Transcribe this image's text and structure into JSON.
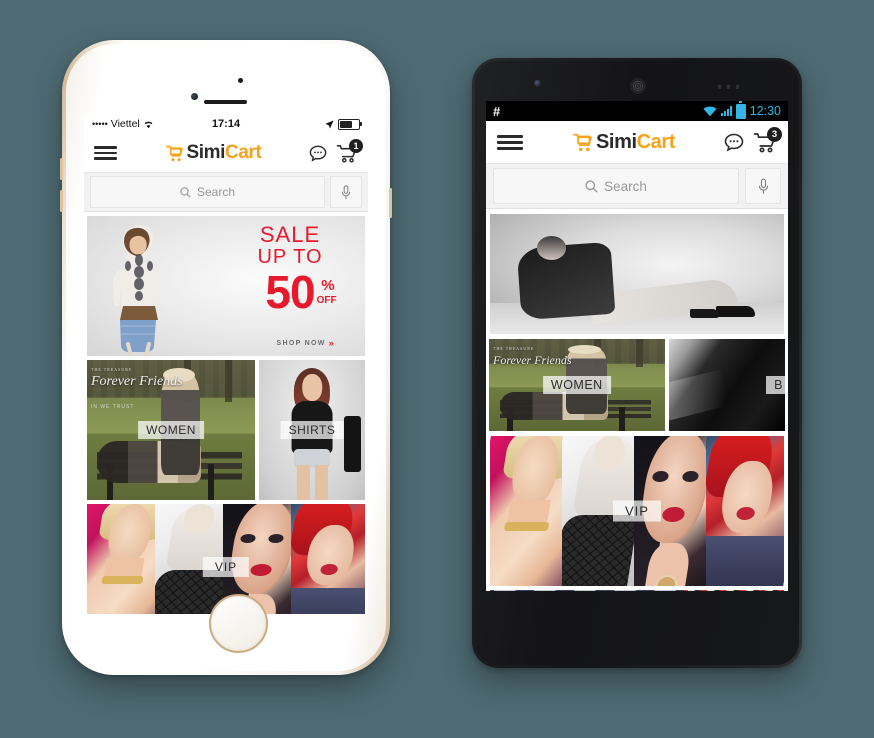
{
  "background_color": "#4e6a72",
  "brand": {
    "name_part1": "Simi",
    "name_part2": "Cart",
    "accent_color": "#f5a31a",
    "dark_color": "#2b2b2b"
  },
  "iphone": {
    "device_name": "iPhone (white/gold)",
    "status_bar": {
      "signal_dots": "•••••",
      "carrier": "Viettel",
      "wifi_icon": "wifi-icon",
      "time": "17:14",
      "location_icon": "location-arrow-icon",
      "battery_icon": "battery-icon"
    },
    "header": {
      "menu_icon": "hamburger-menu-icon",
      "logo_icon": "shopping-cart-logo-icon",
      "chat_icon": "chat-bubble-icon",
      "cart_icon": "shopping-cart-icon",
      "cart_badge": "1"
    },
    "search": {
      "placeholder": "Search",
      "search_icon": "search-icon",
      "mic_icon": "microphone-icon"
    },
    "sale_banner": {
      "line1": "SALE",
      "line2": "UP TO",
      "number": "50",
      "percent": "%",
      "off": "OFF",
      "cta": "SHOP NOW",
      "cta_arrow": "»",
      "text_color": "#e8192c"
    },
    "tiles": [
      {
        "label": "WOMEN",
        "overlay_small": "THE TREASURE",
        "overlay_big": "Forever Friends",
        "overlay_sub": "IN WE TRUST"
      },
      {
        "label": "SHIRTS"
      }
    ],
    "vip_banner": {
      "label": "VIP"
    }
  },
  "android": {
    "device_name": "Android (black)",
    "status_bar": {
      "hash_icon": "#",
      "wifi_icon": "wifi-icon",
      "signal_icon": "signal-bars-icon",
      "battery_icon": "battery-icon",
      "time": "12:30",
      "accent_color": "#33b5e5"
    },
    "header": {
      "menu_icon": "hamburger-menu-icon",
      "logo_icon": "shopping-cart-logo-icon",
      "chat_icon": "chat-bubble-icon",
      "cart_icon": "shopping-cart-icon",
      "cart_badge": "3"
    },
    "search": {
      "placeholder": "Search",
      "search_icon": "search-icon",
      "mic_icon": "microphone-icon"
    },
    "hero_banner": {
      "alt": "black-and-white fashion model banner"
    },
    "tiles": [
      {
        "label": "WOMEN",
        "overlay_small": "THE TREASURE",
        "overlay_big": "Forever Friends"
      },
      {
        "label": "B"
      }
    ],
    "vip_banner": {
      "label": "VIP"
    }
  }
}
